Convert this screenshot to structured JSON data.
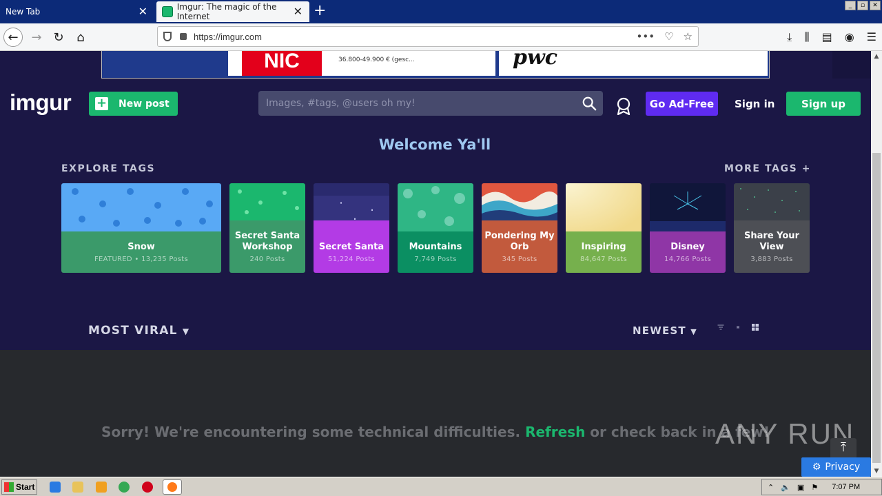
{
  "browser": {
    "tabs": [
      {
        "title": "New Tab"
      },
      {
        "title": "Imgur: The magic of the Internet"
      }
    ],
    "url": "https://imgur.com"
  },
  "ad": {
    "brand_left": "NIC",
    "salary": "36.800-49.900 € (gesc...",
    "brand_right": "pwc"
  },
  "header": {
    "logo": "imgur",
    "new_post": "New post",
    "search_placeholder": "Images, #tags, @users oh my!",
    "go_ad_free": "Go Ad-Free",
    "sign_in": "Sign in",
    "sign_up": "Sign up"
  },
  "welcome": "Welcome Ya'll",
  "explore_tags": "EXPLORE TAGS",
  "more_tags": "MORE TAGS +",
  "tags": [
    {
      "name": "Snow",
      "count": "FEATURED • 13,235 Posts",
      "color": "#3b9a6a",
      "img": "#59a9f5"
    },
    {
      "name": "Secret Santa Workshop",
      "count": "240 Posts",
      "color": "#3b9a6a",
      "img": "#1bb76e"
    },
    {
      "name": "Secret Santa",
      "count": "51,224 Posts",
      "color": "#b33be5",
      "img": "#2a2a6e"
    },
    {
      "name": "Mountains",
      "count": "7,749 Posts",
      "color": "#0b8f62",
      "img": "#2fb685"
    },
    {
      "name": "Pondering My Orb",
      "count": "345 Posts",
      "color": "#c25a3d",
      "img": "#e0573f"
    },
    {
      "name": "Inspiring",
      "count": "84,647 Posts",
      "color": "#76b04d",
      "img": "#f3e6b0"
    },
    {
      "name": "Disney",
      "count": "14,766 Posts",
      "color": "#8f36a6",
      "img": "#10163a"
    },
    {
      "name": "Share Your View",
      "count": "3,883 Posts",
      "color": "#4d4f55",
      "img": "#3b4049"
    }
  ],
  "sort": {
    "section": "MOST VIRAL",
    "order": "NEWEST"
  },
  "error": {
    "before": "Sorry! We're encountering some technical difficulties. ",
    "refresh": "Refresh",
    "after": " or check back in a few!"
  },
  "privacy": "Privacy",
  "watermark": "ANY RUN",
  "taskbar": {
    "start": "Start",
    "clock": "7:07 PM"
  }
}
